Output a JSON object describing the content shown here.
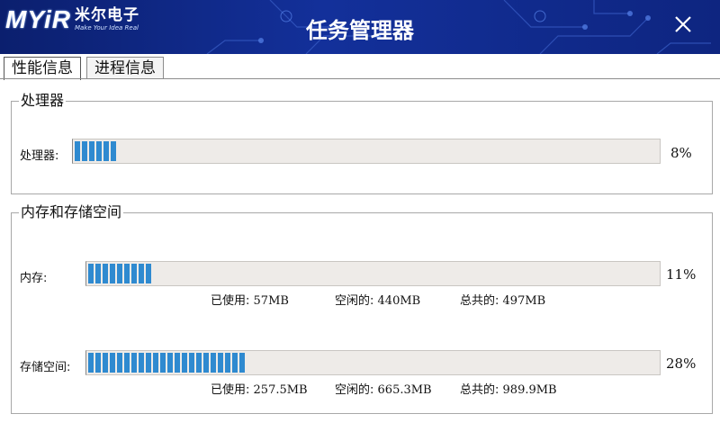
{
  "header": {
    "title": "任务管理器",
    "logo": {
      "mark": "MYiR",
      "cn": "米尔电子",
      "slogan": "Make Your Idea Real"
    },
    "colors": {
      "background": "#13309a",
      "accent": "#2f8ad0"
    }
  },
  "tabs": [
    {
      "label": "性能信息",
      "active": true
    },
    {
      "label": "进程信息",
      "active": false
    }
  ],
  "cpu_group": {
    "title": "处理器",
    "row": {
      "label": "处理器:",
      "percent_text": "8%",
      "value": 8
    }
  },
  "mem_group": {
    "title": "内存和存储空间",
    "memory": {
      "label": "内存:",
      "percent_text": "11%",
      "value": 11,
      "used_label": "已使用:",
      "used": "57MB",
      "free_label": "空闲的:",
      "free": "440MB",
      "total_label": "总共的:",
      "total": "497MB"
    },
    "storage": {
      "label": "存储空间:",
      "percent_text": "28%",
      "value": 28,
      "used_label": "已使用:",
      "used": "257.5MB",
      "free_label": "空闲的:",
      "free": "665.3MB",
      "total_label": "总共的:",
      "total": "989.9MB"
    }
  }
}
